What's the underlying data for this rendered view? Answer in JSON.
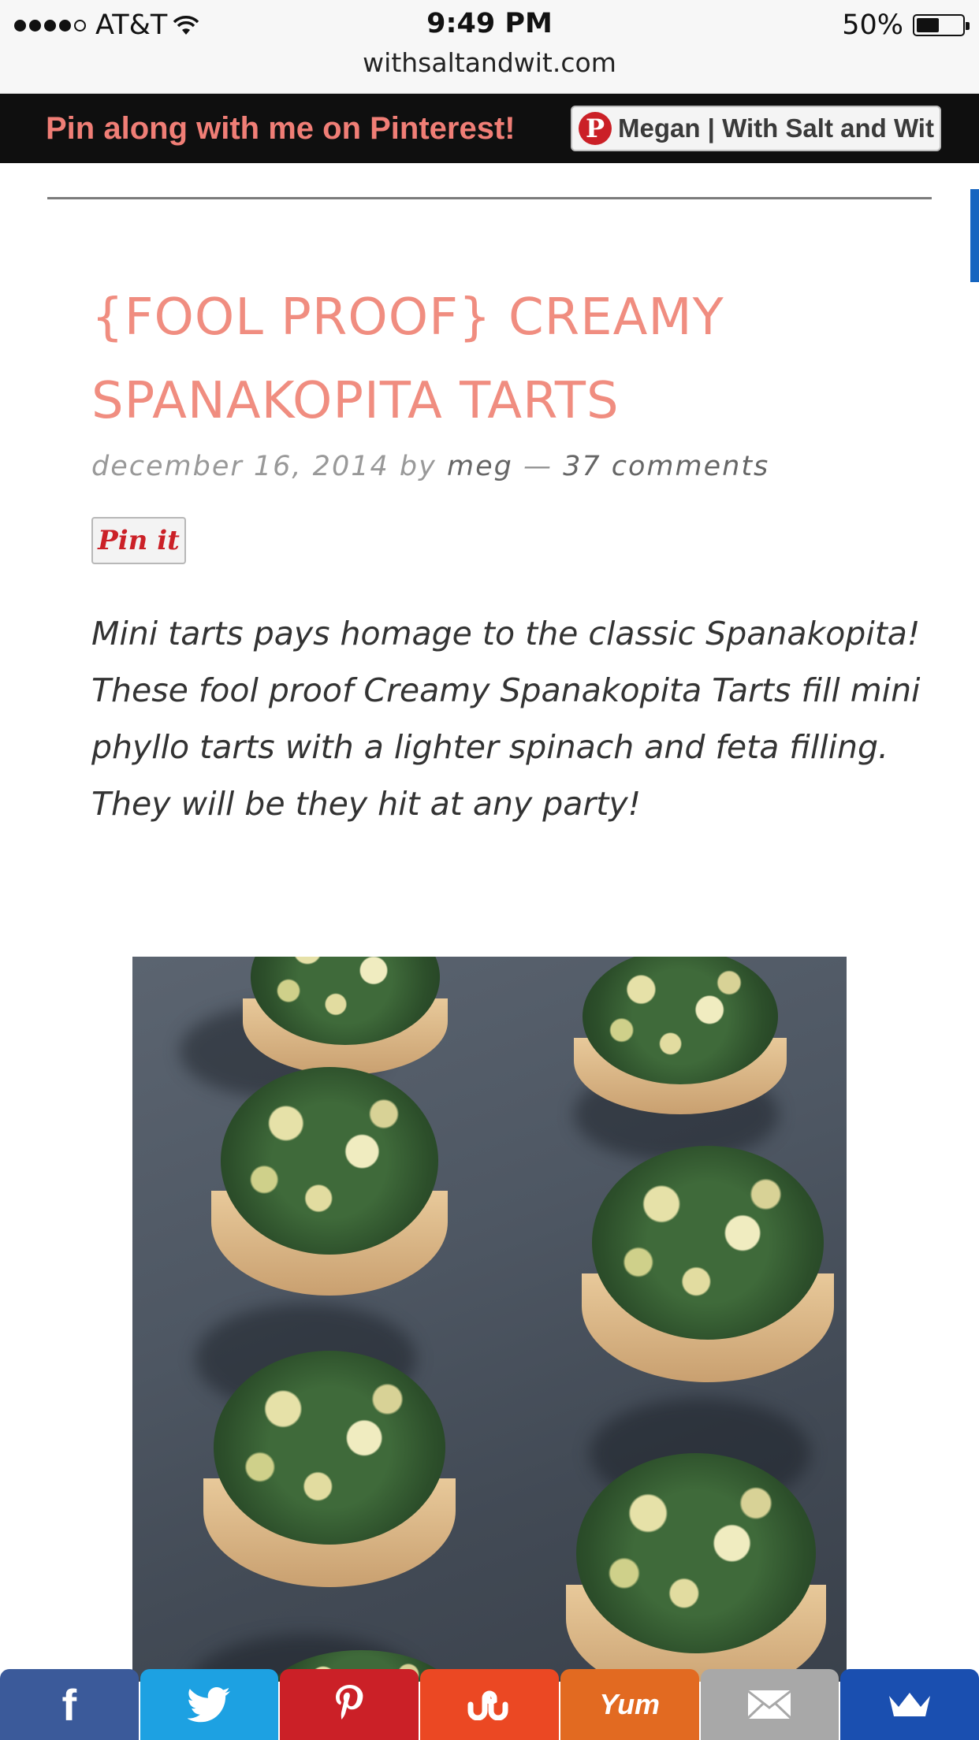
{
  "status_bar": {
    "carrier": "AT&T",
    "time": "9:49 PM",
    "battery_percent": "50%",
    "battery_level": 0.5,
    "url": "withsaltandwit.com"
  },
  "pinterest_bar": {
    "text": "Pin along with me on Pinterest!",
    "follow_button_label": "Megan | With Salt and Wit",
    "logo_letter": "P"
  },
  "post": {
    "title": "{FOOL PROOF} CREAMY SPANAKOPITA TARTS",
    "date": "december 16, 2014",
    "by_label": "by",
    "author": "meg",
    "separator": "—",
    "comments": "37 comments",
    "pin_it_label": "Pin it",
    "intro": "Mini tarts pays homage to the classic Spanakopita! These fool proof Creamy Spanakopita Tarts fill mini phyllo tarts with a lighter spinach and feta filling. They will be they hit at any party!"
  },
  "share_bar": {
    "buttons": [
      {
        "name": "facebook",
        "glyph": "f",
        "color": "#3b5a9a"
      },
      {
        "name": "twitter",
        "glyph": "",
        "color": "#1da1e2"
      },
      {
        "name": "pinterest",
        "glyph": "",
        "color": "#cb2027"
      },
      {
        "name": "stumbleupon",
        "glyph": "",
        "color": "#eb4823"
      },
      {
        "name": "yummly",
        "glyph": "Yum",
        "color": "#e26a21"
      },
      {
        "name": "email",
        "glyph": "",
        "color": "#a8a8a8"
      },
      {
        "name": "more",
        "glyph": "",
        "color": "#1a4fb0"
      }
    ]
  },
  "colors": {
    "accent_title": "#f08d80",
    "pinterest_red": "#cb2027",
    "pinbar_text": "#f07e76"
  }
}
